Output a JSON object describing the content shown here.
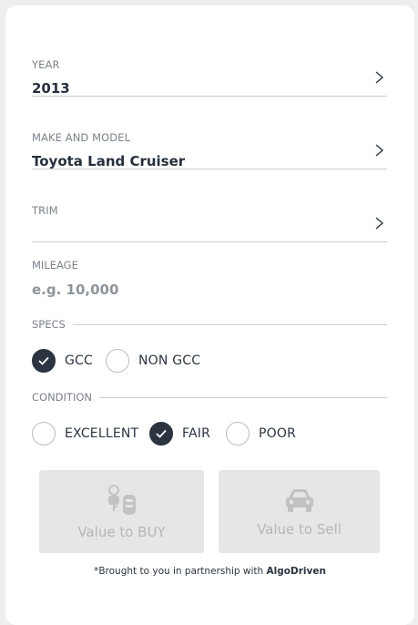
{
  "fields": {
    "year": {
      "label": "YEAR",
      "value": "2013"
    },
    "make_model": {
      "label": "MAKE AND MODEL",
      "value": "Toyota Land Cruiser"
    },
    "trim": {
      "label": "TRIM",
      "value": ""
    },
    "mileage": {
      "label": "MILEAGE",
      "placeholder": "e.g. 10,000"
    }
  },
  "specs": {
    "heading": "SPECS",
    "options": [
      {
        "label": "GCC",
        "checked": true
      },
      {
        "label": "NON GCC",
        "checked": false
      }
    ]
  },
  "condition": {
    "heading": "CONDITION",
    "options": [
      {
        "label": "EXCELLENT",
        "checked": false
      },
      {
        "label": "FAIR",
        "checked": true
      },
      {
        "label": "POOR",
        "checked": false
      }
    ]
  },
  "actions": {
    "buy_label": "Value to BUY",
    "sell_label": "Value to Sell",
    "buy_icon": "car-keys-icon",
    "sell_icon": "car-icon"
  },
  "footer": {
    "prefix": "*Brought to you in partnership with",
    "brand": "AlgoDriven"
  },
  "colors": {
    "dark": "#2b3441",
    "muted": "#7b828b",
    "divider": "#c9cdd2",
    "button_bg": "#e6e6e6",
    "button_text": "#b6b6b6"
  }
}
